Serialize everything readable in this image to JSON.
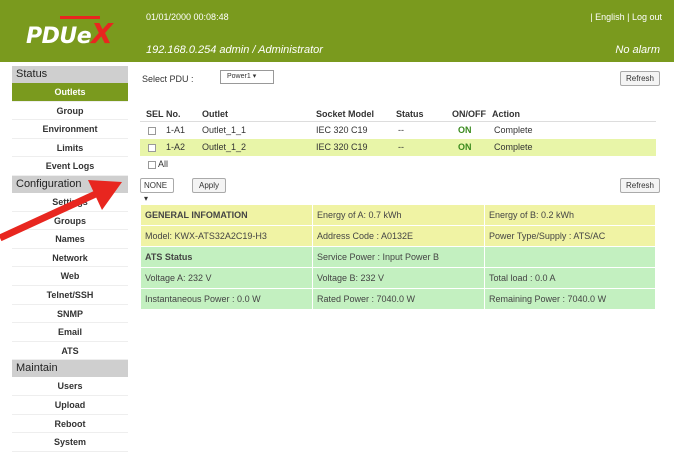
{
  "header": {
    "logo_text": "PDUe",
    "logo_x": "X",
    "datetime": "01/01/2000 00:08:48",
    "lang_link": "English",
    "logout_link": "Log out",
    "link_separator": "|",
    "ip_user": "192.168.0.254  admin / Administrator",
    "alarm_status": "No alarm"
  },
  "sidebar": {
    "sections": [
      {
        "title": "Status",
        "items": [
          "Outlets",
          "Group",
          "Environment",
          "Limits",
          "Event Logs"
        ]
      },
      {
        "title": "Configuration",
        "items": [
          "Settings",
          "Groups",
          "Names",
          "Network",
          "Web",
          "Telnet/SSH",
          "SNMP",
          "Email",
          "ATS"
        ]
      },
      {
        "title": "Maintain",
        "items": [
          "Users",
          "Upload",
          "Reboot",
          "System"
        ]
      }
    ],
    "active_item": "Outlets"
  },
  "pdu": {
    "select_label": "Select PDU :",
    "selected": "Power1",
    "refresh_label": "Refresh"
  },
  "outlets": {
    "columns": [
      "SEL",
      "No.",
      "Outlet",
      "Socket Model",
      "Status",
      "ON/OFF",
      "Action"
    ],
    "rows": [
      {
        "no": "1-A1",
        "outlet": "Outlet_1_1",
        "socket": "IEC 320 C19",
        "status": "--",
        "onoff": "ON",
        "action": "Complete"
      },
      {
        "no": "1-A2",
        "outlet": "Outlet_1_2",
        "socket": "IEC 320 C19",
        "status": "--",
        "onoff": "ON",
        "action": "Complete"
      }
    ],
    "all_label": "All",
    "bulk_select": "NONE",
    "apply_label": "Apply",
    "refresh_label": "Refresh"
  },
  "info": {
    "general_title": "GENERAL INFOMATION",
    "energy_a": "Energy of A: 0.7 kWh",
    "energy_b": "Energy of B: 0.2 kWh",
    "model": "Model: KWX-ATS32A2C19-H3",
    "address": "Address Code : A0132E",
    "power_type": "Power Type/Supply : ATS/AC",
    "ats_title": "ATS Status",
    "service_power": "Service Power : Input Power B",
    "voltage_a": "Voltage A: 232 V",
    "voltage_b": "Voltage B: 232 V",
    "total_load": "Total load : 0.0 A",
    "inst_power": "Instantaneous Power : 0.0 W",
    "rated_power": "Rated Power : 7040.0 W",
    "remaining_power": "Remaining Power : 7040.0 W"
  },
  "colors": {
    "header": "#7a9a1e",
    "active": "#7a9a1e",
    "arrow": "#e8261f",
    "row_alt": "#e8f5a8"
  }
}
